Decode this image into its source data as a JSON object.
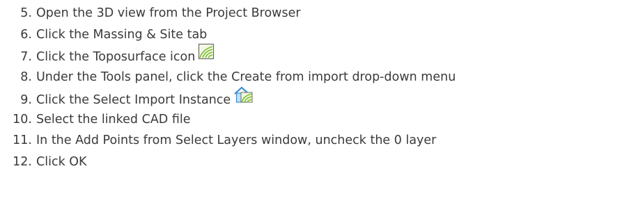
{
  "steps": [
    {
      "number": "5.",
      "text": "Open the 3D view from the Project Browser"
    },
    {
      "number": "6.",
      "text": "Click the Massing & Site tab"
    },
    {
      "number": "7.",
      "text": "Click the Toposurface icon",
      "icon": "toposurface-icon"
    },
    {
      "number": "8.",
      "text": "Under the Tools panel, click the Create from import drop-down menu"
    },
    {
      "number": "9.",
      "text": "Click the Select Import Instance",
      "icon": "select-import-instance-icon"
    },
    {
      "number": "10.",
      "text": "Select the linked CAD file"
    },
    {
      "number": "11.",
      "text": "In the Add Points from Select Layers window, uncheck the 0 layer"
    },
    {
      "number": "12.",
      "text": "Click OK"
    }
  ],
  "colors": {
    "text": "#3a3a3a",
    "icon_green": "#8ec63f",
    "icon_blue": "#3a8fd8"
  }
}
